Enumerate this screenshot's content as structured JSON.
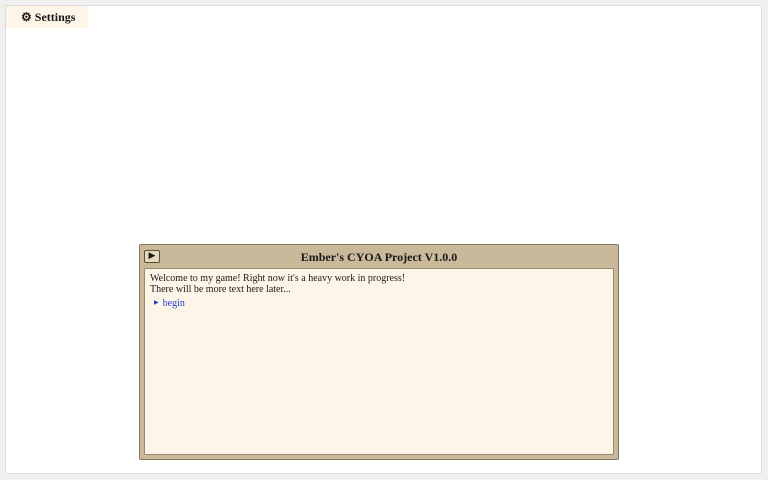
{
  "settings": {
    "icon": "gear-icon",
    "label": "Settings"
  },
  "window": {
    "title": "Ember's CYOA Project V1.0.0",
    "play_button_glyph": "▶",
    "body_lines": [
      "Welcome to my game! Right now it's a heavy work in progress!",
      "There will be more text here later..."
    ],
    "choices": [
      {
        "label": "begin"
      }
    ]
  },
  "colors": {
    "window_frame": "#c9b89a",
    "content_background": "#fdf6e8",
    "link": "#2a3dd6"
  }
}
